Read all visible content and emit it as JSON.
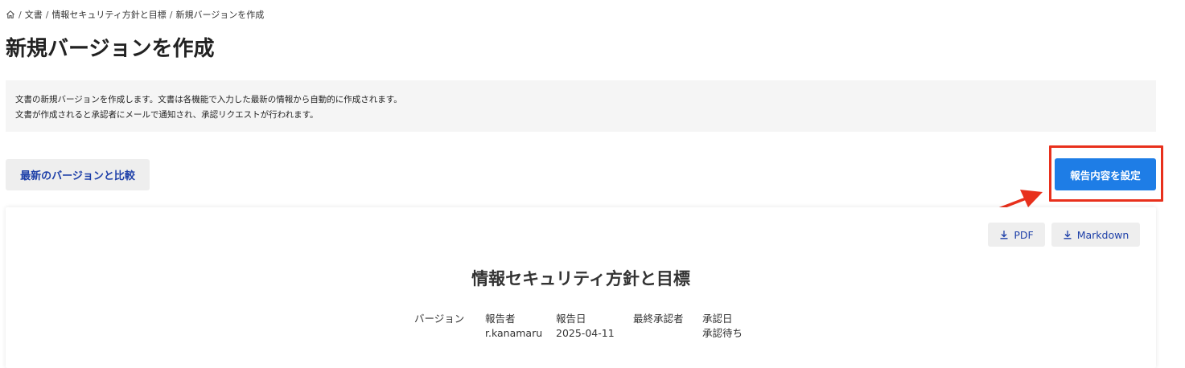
{
  "breadcrumb": {
    "items": [
      "文書",
      "情報セキュリティ方針と目標",
      "新規バージョンを作成"
    ],
    "separator": "/"
  },
  "page": {
    "title": "新規バージョンを作成"
  },
  "info": {
    "line1": "文書の新規バージョンを作成します。文書は各機能で入力した最新の情報から自動的に作成されます。",
    "line2": "文書が作成されると承認者にメールで通知され、承認リクエストが行われます。"
  },
  "actions": {
    "compare_label": "最新のバージョンと比較",
    "report_label": "報告内容を設定"
  },
  "document": {
    "download_pdf": "PDF",
    "download_markdown": "Markdown",
    "title": "情報セキュリティ方針と目標",
    "meta": [
      {
        "label": "バージョン",
        "value": ""
      },
      {
        "label": "報告者",
        "value": "r.kanamaru"
      },
      {
        "label": "報告日",
        "value": "2025-04-11"
      },
      {
        "label": "最終承認者",
        "value": ""
      },
      {
        "label": "承認日",
        "value": "承認待ち"
      }
    ]
  },
  "colors": {
    "primary": "#1e7de6",
    "link": "#1d3fa8",
    "annotation": "#e8301c"
  }
}
